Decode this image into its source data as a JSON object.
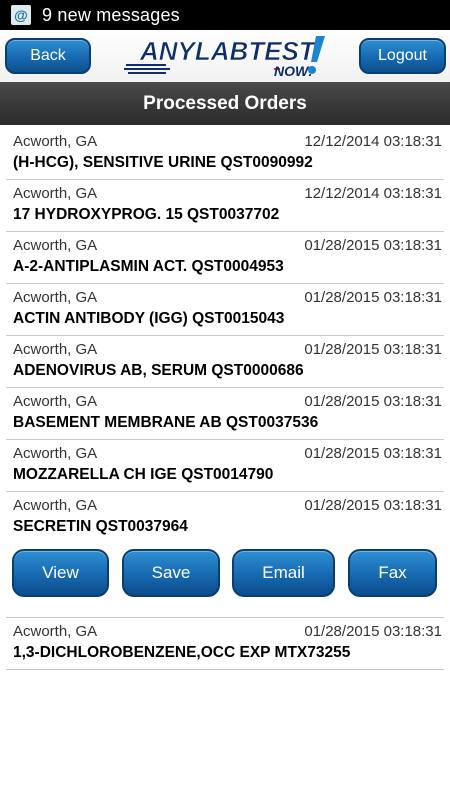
{
  "status_bar": {
    "notification_text": "9 new messages",
    "icon_glyph": "@"
  },
  "header": {
    "back_label": "Back",
    "logout_label": "Logout",
    "logo": {
      "line1": "ANYLABTEST",
      "line2": "NOW!"
    }
  },
  "title": "Processed Orders",
  "orders": [
    {
      "location": "Acworth, GA",
      "timestamp": "12/12/2014 03:18:31",
      "name": "(H-HCG), SENSITIVE URINE QST0090992"
    },
    {
      "location": "Acworth, GA",
      "timestamp": "12/12/2014 03:18:31",
      "name": "17 HYDROXYPROG. 15 QST0037702"
    },
    {
      "location": "Acworth, GA",
      "timestamp": "01/28/2015 03:18:31",
      "name": "A-2-ANTIPLASMIN ACT. QST0004953"
    },
    {
      "location": "Acworth, GA",
      "timestamp": "01/28/2015 03:18:31",
      "name": "ACTIN ANTIBODY (IGG) QST0015043"
    },
    {
      "location": "Acworth, GA",
      "timestamp": "01/28/2015 03:18:31",
      "name": "ADENOVIRUS AB, SERUM QST0000686"
    },
    {
      "location": "Acworth, GA",
      "timestamp": "01/28/2015 03:18:31",
      "name": "BASEMENT MEMBRANE AB QST0037536"
    },
    {
      "location": "Acworth, GA",
      "timestamp": "01/28/2015 03:18:31",
      "name": "MOZZARELLA CH IGE QST0014790"
    },
    {
      "location": "Acworth, GA",
      "timestamp": "01/28/2015 03:18:31",
      "name": "SECRETIN QST0037964"
    },
    {
      "location": "Acworth, GA",
      "timestamp": "01/28/2015 03:18:31",
      "name": "1,3-DICHLOROBENZENE,OCC EXP MTX73255"
    }
  ],
  "actions": {
    "view": "View",
    "save": "Save",
    "email": "Email",
    "fax": "Fax"
  },
  "colors": {
    "button_blue": "#1669b0",
    "title_bar": "#333333",
    "status_bar": "#000000",
    "logo_red": "#d6262c",
    "logo_navy": "#0f2f66"
  }
}
